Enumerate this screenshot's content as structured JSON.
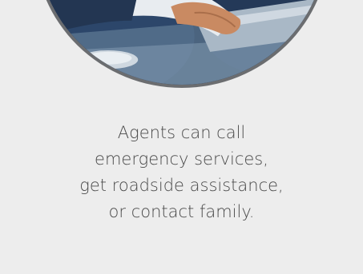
{
  "image": {
    "icon": "office-worker-at-laptop-photo",
    "border_color": "#6b6d70"
  },
  "caption": {
    "lines": [
      "Agents can call",
      "emergency services,",
      "get roadside assistance,",
      "or contact family."
    ],
    "color": "#4a4a4a"
  },
  "background_color": "#ededed"
}
